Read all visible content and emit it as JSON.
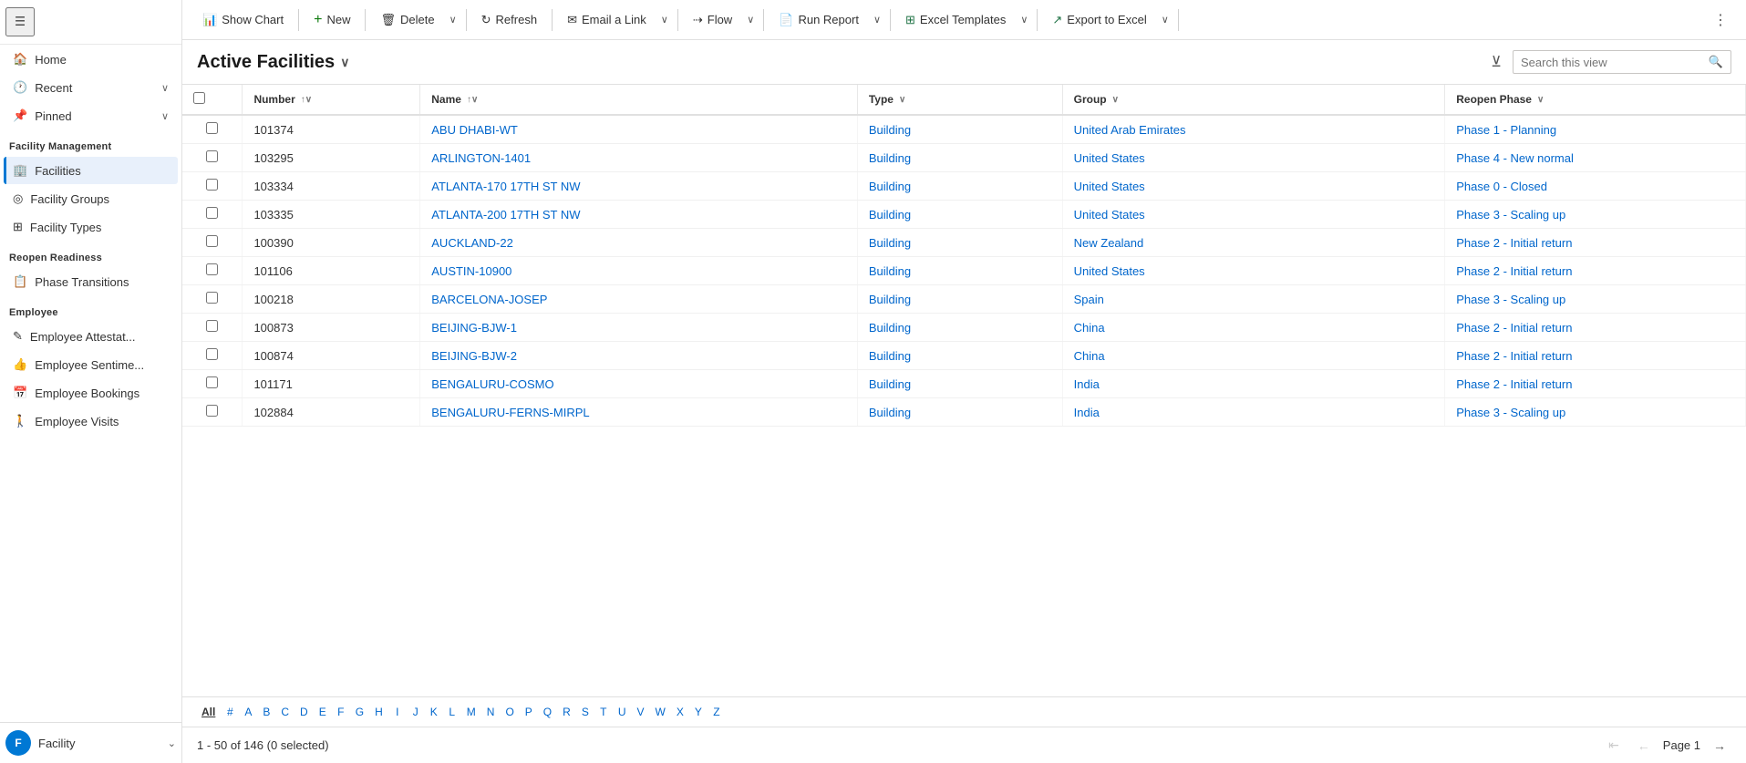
{
  "sidebar": {
    "nav_items": [
      {
        "id": "home",
        "label": "Home",
        "icon": "🏠",
        "has_chevron": false
      },
      {
        "id": "recent",
        "label": "Recent",
        "icon": "🕐",
        "has_chevron": true
      },
      {
        "id": "pinned",
        "label": "Pinned",
        "icon": "📌",
        "has_chevron": true
      }
    ],
    "sections": [
      {
        "header": "Facility Management",
        "items": [
          {
            "id": "facilities",
            "label": "Facilities",
            "icon": "🏢",
            "active": true
          },
          {
            "id": "facility-groups",
            "label": "Facility Groups",
            "icon": "◎"
          },
          {
            "id": "facility-types",
            "label": "Facility Types",
            "icon": "⊞"
          }
        ]
      },
      {
        "header": "Reopen Readiness",
        "items": [
          {
            "id": "phase-transitions",
            "label": "Phase Transitions",
            "icon": "📋"
          }
        ]
      },
      {
        "header": "Employee",
        "items": [
          {
            "id": "employee-attest",
            "label": "Employee Attestat...",
            "icon": "✎"
          },
          {
            "id": "employee-sentiment",
            "label": "Employee Sentime...",
            "icon": "👍"
          },
          {
            "id": "employee-bookings",
            "label": "Employee Bookings",
            "icon": "📅"
          },
          {
            "id": "employee-visits",
            "label": "Employee Visits",
            "icon": "🚶"
          }
        ]
      }
    ],
    "footer": {
      "avatar_letter": "F",
      "label": "Facility",
      "expand_icon": "⌄"
    }
  },
  "toolbar": {
    "show_chart_label": "Show Chart",
    "new_label": "New",
    "delete_label": "Delete",
    "refresh_label": "Refresh",
    "email_link_label": "Email a Link",
    "flow_label": "Flow",
    "run_report_label": "Run Report",
    "excel_templates_label": "Excel Templates",
    "export_excel_label": "Export to Excel"
  },
  "view_header": {
    "title": "Active Facilities",
    "search_placeholder": "Search this view"
  },
  "grid": {
    "columns": [
      {
        "id": "number",
        "label": "Number",
        "sort": "asc"
      },
      {
        "id": "name",
        "label": "Name",
        "sort": "asc"
      },
      {
        "id": "type",
        "label": "Type",
        "sort": null
      },
      {
        "id": "group",
        "label": "Group",
        "sort": null
      },
      {
        "id": "reopen_phase",
        "label": "Reopen Phase",
        "sort": null
      }
    ],
    "rows": [
      {
        "number": "101374",
        "name": "ABU DHABI-WT",
        "type": "Building",
        "group": "United Arab Emirates",
        "reopen_phase": "Phase 1 - Planning"
      },
      {
        "number": "103295",
        "name": "ARLINGTON-1401",
        "type": "Building",
        "group": "United States",
        "reopen_phase": "Phase 4 - New normal"
      },
      {
        "number": "103334",
        "name": "ATLANTA-170 17TH ST NW",
        "type": "Building",
        "group": "United States",
        "reopen_phase": "Phase 0 - Closed"
      },
      {
        "number": "103335",
        "name": "ATLANTA-200 17TH ST NW",
        "type": "Building",
        "group": "United States",
        "reopen_phase": "Phase 3 - Scaling up"
      },
      {
        "number": "100390",
        "name": "AUCKLAND-22",
        "type": "Building",
        "group": "New Zealand",
        "reopen_phase": "Phase 2 - Initial return"
      },
      {
        "number": "101106",
        "name": "AUSTIN-10900",
        "type": "Building",
        "group": "United States",
        "reopen_phase": "Phase 2 - Initial return"
      },
      {
        "number": "100218",
        "name": "BARCELONA-JOSEP",
        "type": "Building",
        "group": "Spain",
        "reopen_phase": "Phase 3 - Scaling up"
      },
      {
        "number": "100873",
        "name": "BEIJING-BJW-1",
        "type": "Building",
        "group": "China",
        "reopen_phase": "Phase 2 - Initial return"
      },
      {
        "number": "100874",
        "name": "BEIJING-BJW-2",
        "type": "Building",
        "group": "China",
        "reopen_phase": "Phase 2 - Initial return"
      },
      {
        "number": "101171",
        "name": "BENGALURU-COSMO",
        "type": "Building",
        "group": "India",
        "reopen_phase": "Phase 2 - Initial return"
      },
      {
        "number": "102884",
        "name": "BENGALURU-FERNS-MIRPL",
        "type": "Building",
        "group": "India",
        "reopen_phase": "Phase 3 - Scaling up"
      }
    ]
  },
  "alpha_bar": {
    "letters": [
      "All",
      "#",
      "A",
      "B",
      "C",
      "D",
      "E",
      "F",
      "G",
      "H",
      "I",
      "J",
      "K",
      "L",
      "M",
      "N",
      "O",
      "P",
      "Q",
      "R",
      "S",
      "T",
      "U",
      "V",
      "W",
      "X",
      "Y",
      "Z"
    ],
    "active": "All"
  },
  "pagination": {
    "range_text": "1 - 50 of 146 (0 selected)",
    "page_label": "Page 1"
  }
}
